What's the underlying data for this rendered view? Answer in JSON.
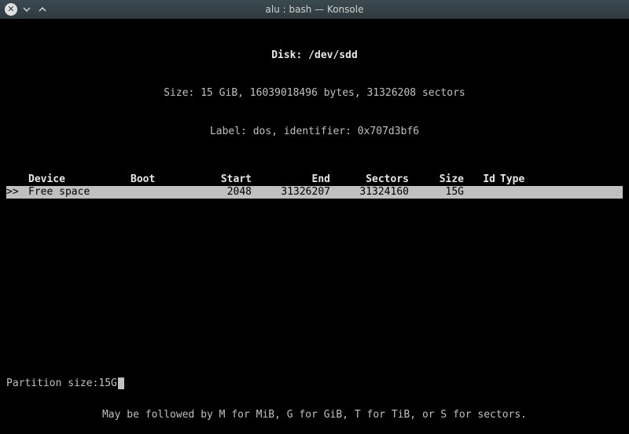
{
  "window": {
    "title": "alu : bash — Konsole",
    "close_icon": "close-icon",
    "min_icon": "minimize-icon",
    "max_icon": "maximize-icon"
  },
  "disk_header": {
    "disk_line": "Disk: /dev/sdd",
    "size_line": "Size: 15 GiB, 16039018496 bytes, 31326208 sectors",
    "label_line": "Label: dos, identifier: 0x707d3bf6"
  },
  "columns": {
    "device": "Device",
    "boot": "Boot",
    "start": "Start",
    "end": "End",
    "sectors": "Sectors",
    "size": "Size",
    "id": "Id",
    "type": "Type"
  },
  "rows": [
    {
      "cursor": ">>",
      "device": "Free space",
      "boot": "",
      "start": "2048",
      "end": "31326207",
      "sectors": "31324160",
      "size": "15G",
      "id": "",
      "type": ""
    }
  ],
  "prompt": {
    "label": "Partition size: ",
    "value": "15G"
  },
  "footer": {
    "hint": "May be followed by M for MiB, G for GiB, T for TiB, or S for sectors."
  }
}
